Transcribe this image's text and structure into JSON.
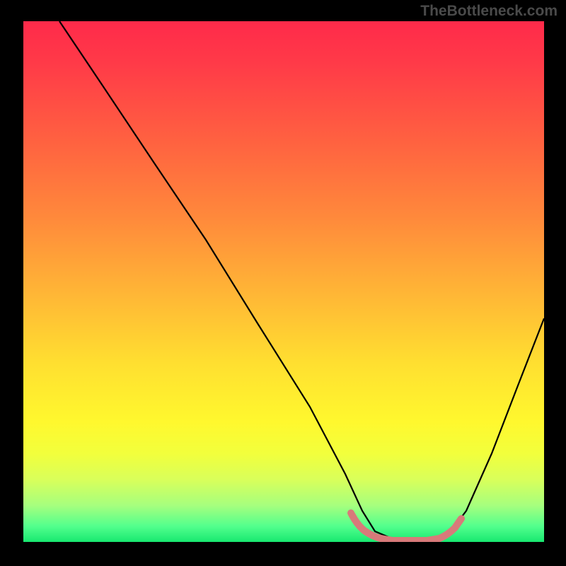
{
  "watermark": "TheBottleneck.com",
  "chart_data": {
    "type": "line",
    "title": "",
    "xlabel": "",
    "ylabel": "",
    "xlim": [
      0,
      100
    ],
    "ylim": [
      0,
      100
    ],
    "curve": {
      "description": "Bottleneck curve — V shaped valley at approximately x ≈ 72 where y ≈ 0",
      "points": [
        {
          "x": 7,
          "y": 100
        },
        {
          "x": 15,
          "y": 88
        },
        {
          "x": 25,
          "y": 73
        },
        {
          "x": 35,
          "y": 58
        },
        {
          "x": 45,
          "y": 42
        },
        {
          "x": 55,
          "y": 26
        },
        {
          "x": 62,
          "y": 13
        },
        {
          "x": 65,
          "y": 6
        },
        {
          "x": 68,
          "y": 2
        },
        {
          "x": 72,
          "y": 0
        },
        {
          "x": 78,
          "y": 0
        },
        {
          "x": 82,
          "y": 2
        },
        {
          "x": 85,
          "y": 6
        },
        {
          "x": 90,
          "y": 17
        },
        {
          "x": 95,
          "y": 30
        },
        {
          "x": 100,
          "y": 43
        }
      ]
    },
    "highlight_band": {
      "description": "Pink highlighted optimal region at valley bottom",
      "x_start": 63,
      "x_end": 82,
      "color": "#d87a7a"
    },
    "gradient_colors": {
      "top": "#ff2a4a",
      "mid": "#ffe030",
      "bottom": "#18e870"
    }
  }
}
